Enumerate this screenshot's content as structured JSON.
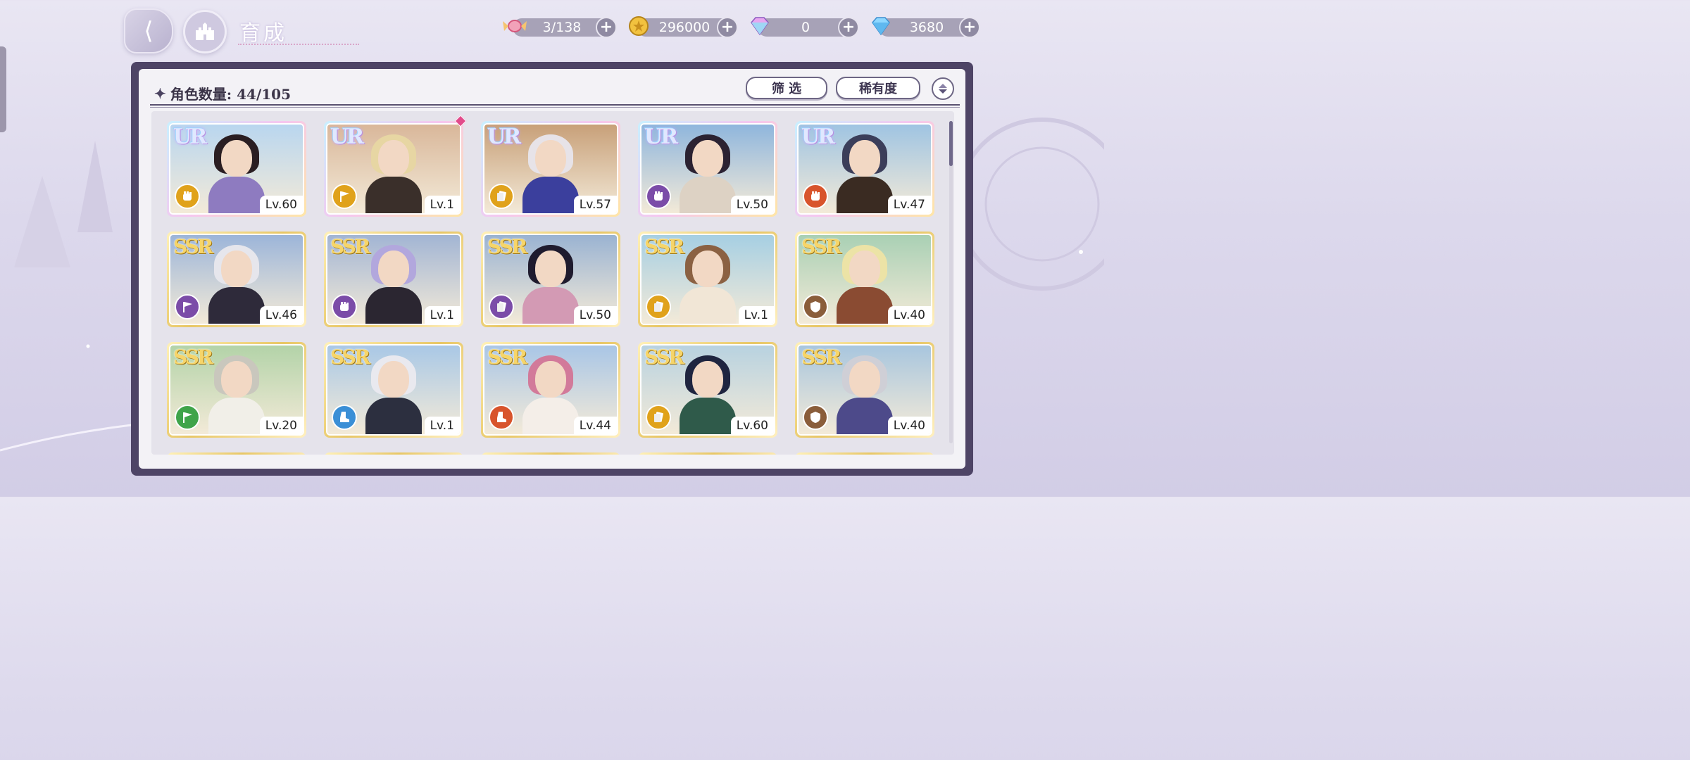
{
  "header": {
    "title": "育成",
    "resources": [
      {
        "name": "candy",
        "icon": "candy-icon",
        "value": "3/138"
      },
      {
        "name": "gold",
        "icon": "gold-coin-icon",
        "value": "296000"
      },
      {
        "name": "rainbow-gem",
        "icon": "rainbow-diamond-icon",
        "value": "0"
      },
      {
        "name": "diamond",
        "icon": "diamond-icon",
        "value": "3680"
      }
    ]
  },
  "panel": {
    "count_label": "角色数量: 44/105",
    "filter_label": "筛 选",
    "rarity_label": "稀有度"
  },
  "cards": [
    {
      "rarity": "UR",
      "level": "Lv.60",
      "attr": "fist",
      "attr_color": "#e0a21b",
      "hair": "#2a1e22",
      "outfit": "#8e7bc0",
      "bg": "#b9d6ef",
      "new": false
    },
    {
      "rarity": "UR",
      "level": "Lv.1",
      "attr": "flag",
      "attr_color": "#e0a21b",
      "hair": "#e7d6a3",
      "outfit": "#3a2f2a",
      "bg": "#d9b79a",
      "new": true
    },
    {
      "rarity": "UR",
      "level": "Lv.57",
      "attr": "card",
      "attr_color": "#e0a21b",
      "hair": "#e7e3e8",
      "outfit": "#3b3f9d",
      "bg": "#c8a079",
      "new": false
    },
    {
      "rarity": "UR",
      "level": "Lv.50",
      "attr": "fist",
      "attr_color": "#7b4ca8",
      "hair": "#2b2232",
      "outfit": "#ddd2c4",
      "bg": "#8fb6dd",
      "new": false
    },
    {
      "rarity": "UR",
      "level": "Lv.47",
      "attr": "fist",
      "attr_color": "#d8542c",
      "hair": "#3b3e5a",
      "outfit": "#3a2b22",
      "bg": "#9fc4e2",
      "new": false
    },
    {
      "rarity": "SSR",
      "level": "Lv.46",
      "attr": "flag",
      "attr_color": "#7b4ca8",
      "hair": "#e6e6ec",
      "outfit": "#2e2a3a",
      "bg": "#9cb5d9",
      "new": false
    },
    {
      "rarity": "SSR",
      "level": "Lv.1",
      "attr": "fist",
      "attr_color": "#7b4ca8",
      "hair": "#b2a7dd",
      "outfit": "#2b2631",
      "bg": "#a2b5d4",
      "new": false
    },
    {
      "rarity": "SSR",
      "level": "Lv.50",
      "attr": "card",
      "attr_color": "#7b4ca8",
      "hair": "#1f1b2e",
      "outfit": "#d39ab4",
      "bg": "#9ab3d2",
      "new": false
    },
    {
      "rarity": "SSR",
      "level": "Lv.1",
      "attr": "card",
      "attr_color": "#e0a21b",
      "hair": "#8b6142",
      "outfit": "#f1e6d6",
      "bg": "#a6cfe3",
      "new": false
    },
    {
      "rarity": "SSR",
      "level": "Lv.40",
      "attr": "shield",
      "attr_color": "#8a5d3a",
      "hair": "#ece3a6",
      "outfit": "#8a4b32",
      "bg": "#a9d0b4",
      "new": false
    },
    {
      "rarity": "SSR",
      "level": "Lv.20",
      "attr": "flag",
      "attr_color": "#3fa44a",
      "hair": "#c9c7bd",
      "outfit": "#f1efe8",
      "bg": "#b3d3a8",
      "new": false
    },
    {
      "rarity": "SSR",
      "level": "Lv.1",
      "attr": "boot",
      "attr_color": "#3a8fd6",
      "hair": "#e9e9ef",
      "outfit": "#2c2f3f",
      "bg": "#a9c8e6",
      "new": false
    },
    {
      "rarity": "SSR",
      "level": "Lv.44",
      "attr": "boot",
      "attr_color": "#d8542c",
      "hair": "#d27a9a",
      "outfit": "#f4eee8",
      "bg": "#a9c6e6",
      "new": false
    },
    {
      "rarity": "SSR",
      "level": "Lv.60",
      "attr": "card",
      "attr_color": "#e0a21b",
      "hair": "#1f2540",
      "outfit": "#2f5a4a",
      "bg": "#b8d2e0",
      "new": false
    },
    {
      "rarity": "SSR",
      "level": "Lv.40",
      "attr": "shield",
      "attr_color": "#8a5d3a",
      "hair": "#cfcfd6",
      "outfit": "#4d4a8a",
      "bg": "#a8c6de",
      "new": false
    }
  ]
}
